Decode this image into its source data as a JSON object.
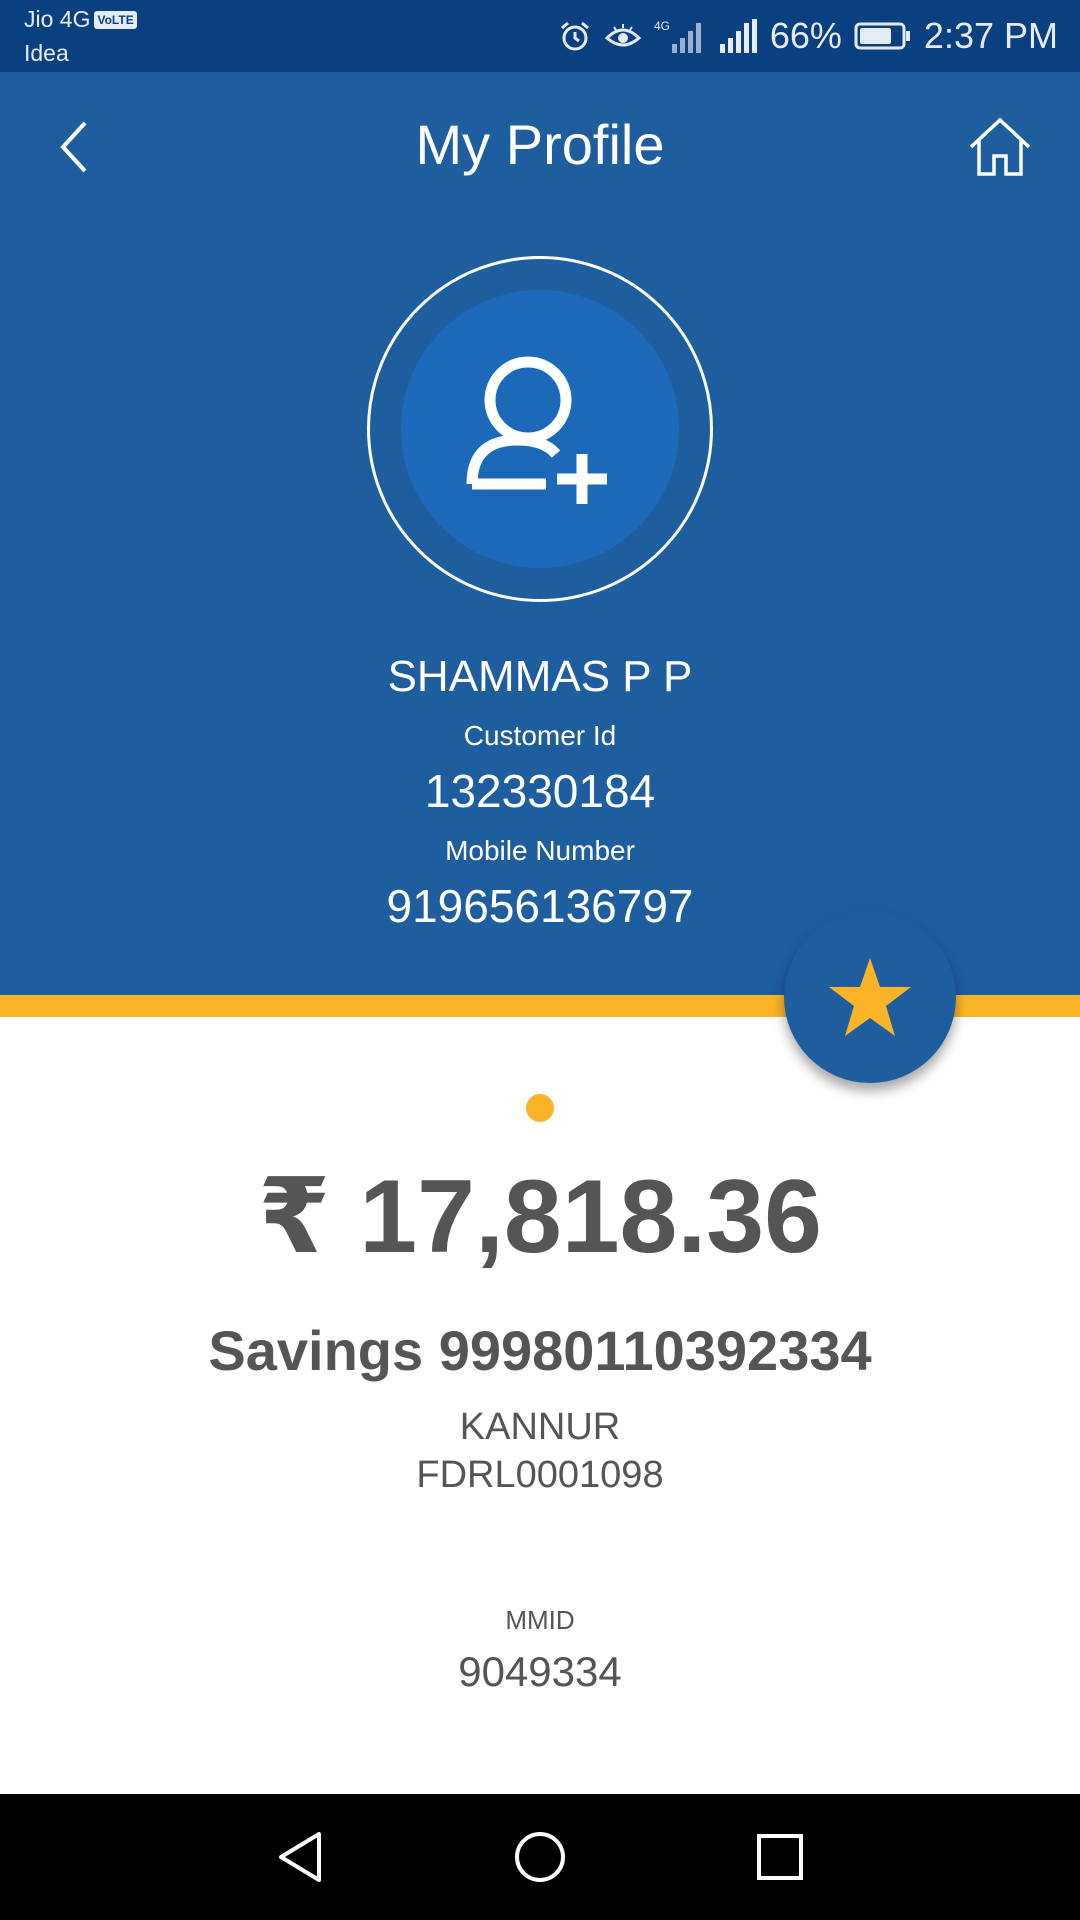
{
  "status_bar": {
    "carrier_primary": "Jio 4G",
    "volte_badge": "VoLTE",
    "carrier_secondary": "Idea",
    "network_type": "4G",
    "battery_percent": "66%",
    "time": "2:37 PM",
    "icons": [
      "alarm-icon",
      "eye-icon",
      "signal-icon",
      "signal-icon",
      "battery-icon"
    ]
  },
  "header": {
    "title": "My Profile",
    "back_icon": "chevron-left-icon",
    "home_icon": "home-icon",
    "background_color": "#1e5e9f"
  },
  "profile": {
    "avatar_icon": "add-user-icon",
    "name": "SHAMMAS P P",
    "customer_id_label": "Customer Id",
    "customer_id": "132330184",
    "mobile_label": "Mobile Number",
    "mobile_number": "919656136797"
  },
  "favorite_button": {
    "icon": "star-icon",
    "star_color": "#fbb428"
  },
  "account": {
    "balance": "₹ 17,818.36",
    "account_line": "Savings 99980110392334",
    "branch": "KANNUR",
    "ifsc": "FDRL0001098",
    "mmid_label": "MMID",
    "mmid": "9049334"
  },
  "accent_color": "#fbb428",
  "nav_bar": {
    "icons": [
      "nav-back-icon",
      "nav-home-icon",
      "nav-recents-icon"
    ]
  }
}
